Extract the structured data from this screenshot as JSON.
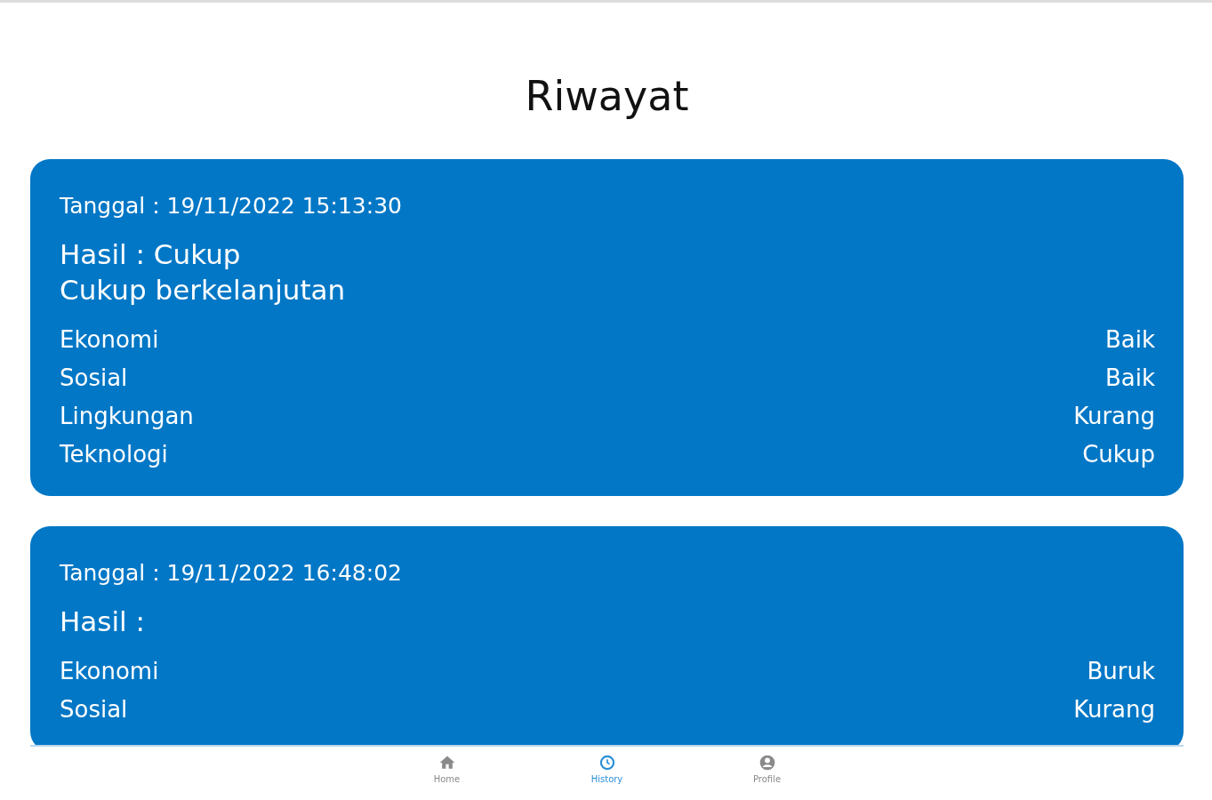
{
  "title": "Riwayat",
  "records": [
    {
      "date": "Tanggal : 19/11/2022 15:13:30",
      "result": "Hasil : Cukup",
      "description": "Cukup berkelanjutan",
      "aspects": [
        {
          "name": "Ekonomi",
          "value": "Baik"
        },
        {
          "name": "Sosial",
          "value": "Baik"
        },
        {
          "name": "Lingkungan",
          "value": "Kurang"
        },
        {
          "name": "Teknologi",
          "value": "Cukup"
        }
      ]
    },
    {
      "date": "Tanggal : 19/11/2022 16:48:02",
      "result": "Hasil :",
      "aspects": [
        {
          "name": "Ekonomi",
          "value": "Buruk"
        },
        {
          "name": "Sosial",
          "value": "Kurang"
        }
      ]
    }
  ],
  "nav": [
    {
      "kind": "home",
      "label": "Home",
      "selected": false
    },
    {
      "kind": "history",
      "label": "History",
      "selected": true
    },
    {
      "kind": "profile",
      "label": "Profile",
      "selected": false
    }
  ]
}
